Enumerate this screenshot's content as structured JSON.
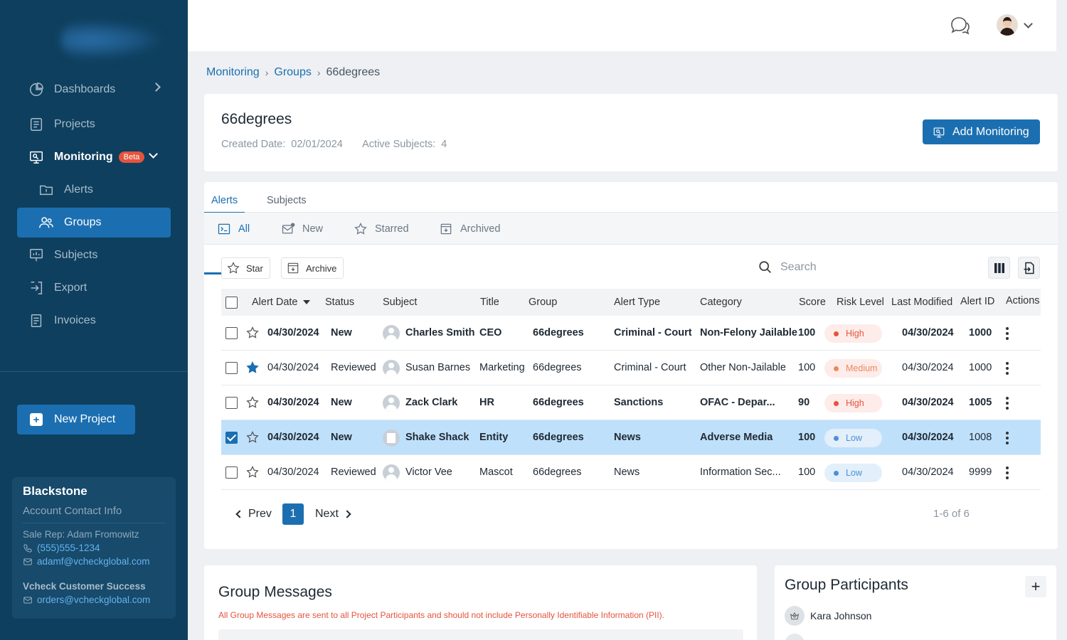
{
  "sidebar": {
    "items": [
      {
        "label": "Dashboards",
        "icon": "chart-pie-icon"
      },
      {
        "label": "Projects",
        "icon": "list-icon"
      },
      {
        "label": "Monitoring",
        "icon": "monitor-icon",
        "badge": "Beta"
      },
      {
        "label": "Alerts",
        "icon": "folder-alert-icon"
      },
      {
        "label": "Groups",
        "icon": "users-icon"
      },
      {
        "label": "Subjects",
        "icon": "presentation-icon"
      },
      {
        "label": "Export",
        "icon": "export-icon"
      },
      {
        "label": "Invoices",
        "icon": "invoice-icon"
      }
    ],
    "new_project": "New Project",
    "account": {
      "name": "Blackstone",
      "subtitle": "Account Contact Info",
      "sale_rep": "Sale Rep: Adam Fromowitz",
      "phone": "(555)555-1234",
      "email": "adamf@vcheckglobal.com",
      "cs_title": "Vcheck Customer Success",
      "cs_email": "orders@vcheckglobal.com"
    }
  },
  "breadcrumb": {
    "c1": "Monitoring",
    "c2": "Groups",
    "current": "66degrees"
  },
  "header": {
    "title": "66degrees",
    "created_label": "Created Date:",
    "created_value": "02/01/2024",
    "active_label": "Active Subjects:",
    "active_value": "4",
    "add_button": "Add Monitoring"
  },
  "tabs": {
    "primary": [
      "Alerts",
      "Subjects"
    ],
    "secondary": [
      "All",
      "New",
      "Starred",
      "Archived"
    ]
  },
  "toolbar": {
    "star": "Star",
    "archive": "Archive",
    "search_placeholder": "Search"
  },
  "table": {
    "columns": [
      "Alert Date",
      "Status",
      "Subject",
      "Title",
      "Group",
      "Alert Type",
      "Category",
      "Score",
      "Risk Level",
      "Last Modified",
      "Alert ID",
      "Actions"
    ],
    "rows": [
      {
        "date": "04/30/2024",
        "status": "New",
        "subject": "Charles Smith",
        "title": "CEO",
        "group": "66degrees",
        "type": "Criminal - Court",
        "category": "Non-Felony Jailable",
        "score": "100",
        "risk": "High",
        "modified": "04/30/2024",
        "id": "1000"
      },
      {
        "date": "04/30/2024",
        "status": "Reviewed",
        "subject": "Susan Barnes",
        "title": "Marketing",
        "group": "66degrees",
        "type": "Criminal - Court",
        "category": "Other Non-Jailable",
        "score": "100",
        "risk": "Medium",
        "modified": "04/30/2024",
        "id": "1000"
      },
      {
        "date": "04/30/2024",
        "status": "New",
        "subject": "Zack Clark",
        "title": "HR",
        "group": "66degrees",
        "type": "Sanctions",
        "category": "OFAC - Depar...",
        "score": "90",
        "risk": "High",
        "modified": "04/30/2024",
        "id": "1005"
      },
      {
        "date": "04/30/2024",
        "status": "New",
        "subject": "Shake Shack",
        "title": "Entity",
        "group": "66degrees",
        "type": "News",
        "category": "Adverse Media",
        "score": "100",
        "risk": "Low",
        "modified": "04/30/2024",
        "id": "1008"
      },
      {
        "date": "04/30/2024",
        "status": "Reviewed",
        "subject": "Victor Vee",
        "title": "Mascot",
        "group": "66degrees",
        "type": "News",
        "category": "Information Sec...",
        "score": "100",
        "risk": "Low",
        "modified": "04/30/2024",
        "id": "9999"
      }
    ]
  },
  "pagination": {
    "prev": "Prev",
    "page": "1",
    "next": "Next",
    "count": "1-6 of 6"
  },
  "messages": {
    "title": "Group Messages",
    "warning": "All Group Messages are sent to all Project Participants and should not include Personally Identifiable Information (PII)."
  },
  "participants": {
    "title": "Group Participants",
    "add": "+",
    "first": "Kara Johnson"
  }
}
